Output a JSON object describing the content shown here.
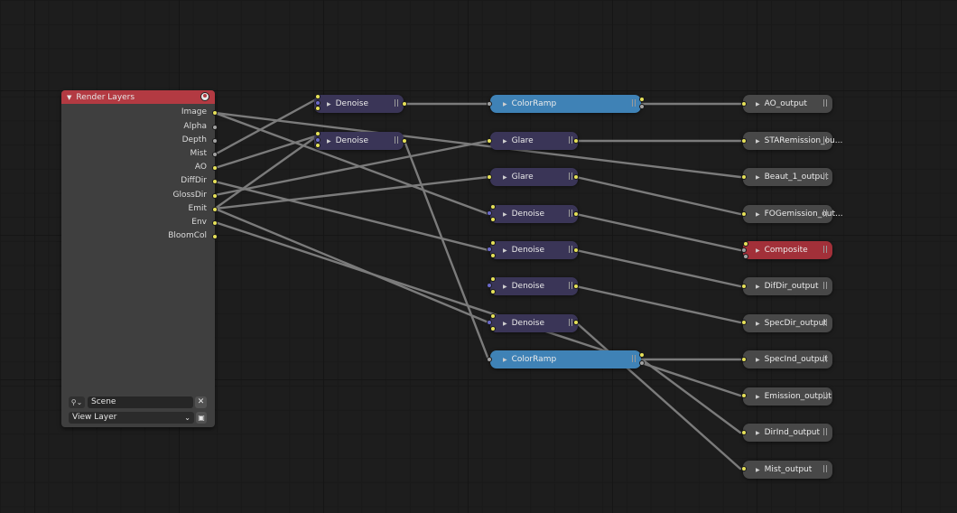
{
  "render_layers": {
    "title": "Render Layers",
    "outputs": [
      "Image",
      "Alpha",
      "Depth",
      "Mist",
      "AO",
      "DiffDir",
      "GlossDir",
      "Emit",
      "Env",
      "BloomCol"
    ],
    "scene": "Scene",
    "view_layer": "View Layer"
  },
  "column1": {
    "denoise_a": "Denoise",
    "denoise_b": "Denoise"
  },
  "column2": {
    "colorramp_a": "ColorRamp",
    "glare_a": "Glare",
    "glare_b": "Glare",
    "denoise_c": "Denoise",
    "denoise_d": "Denoise",
    "denoise_e": "Denoise",
    "denoise_f": "Denoise",
    "colorramp_b": "ColorRamp"
  },
  "outputs": {
    "ao": "AO_output",
    "staremission": "STARemission_ou...",
    "beaut": "Beaut_1_output",
    "fogemission": "FOGemission_out...",
    "composite": "Composite",
    "difdir": "DifDir_output",
    "specdir": "SpecDir_output",
    "specind": "SpecInd_output",
    "emission": "Emission_output",
    "dirind": "DirInd_output",
    "mist": "Mist_output"
  },
  "colors": {
    "render_layers_header": "#b33a42",
    "denoise": "#3a3557",
    "colorramp": "#3f82b6",
    "output": "#484848",
    "composite": "#a23039",
    "socket_color": "#e6e159",
    "socket_float": "#a2a2a2",
    "socket_vector": "#6a69c9",
    "wire": "#7b7b7b"
  }
}
